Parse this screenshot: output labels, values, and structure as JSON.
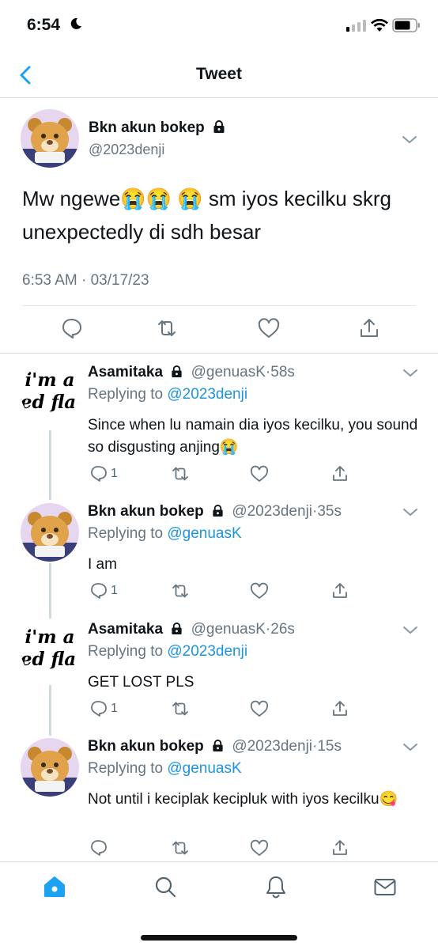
{
  "status": {
    "time": "6:54"
  },
  "nav": {
    "title": "Tweet"
  },
  "main_tweet": {
    "name": "Bkn akun bokep",
    "handle": "@2023denji",
    "text": "Mw ngewe😭😭 😭 sm iyos kecilku skrg unexpectedly di sdh besar",
    "timestamp": "6:53 AM · 03/17/23"
  },
  "replies": [
    {
      "name": "Asamitaka",
      "handle": "@genuasK",
      "time": "58s",
      "replying_label": "Replying to",
      "replying_to": "@2023denji",
      "text": "Since when lu namain dia iyos kecilku, you sound so disgusting anjing😭",
      "reply_count": "1",
      "avatar": "red-flag"
    },
    {
      "name": "Bkn akun bokep",
      "handle": "@2023denji",
      "time": "35s",
      "replying_label": "Replying to",
      "replying_to": "@genuasK",
      "text": "I am",
      "reply_count": "1",
      "avatar": "bear"
    },
    {
      "name": "Asamitaka",
      "handle": "@genuasK",
      "time": "26s",
      "replying_label": "Replying to",
      "replying_to": "@2023denji",
      "text": "GET LOST PLS",
      "reply_count": "1",
      "avatar": "red-flag"
    },
    {
      "name": "Bkn akun bokep",
      "handle": "@2023denji",
      "time": "15s",
      "replying_label": "Replying to",
      "replying_to": "@genuasK",
      "text": "Not until i keciplak kecipluk with iyos kecilku😋",
      "reply_count": "",
      "avatar": "bear"
    }
  ],
  "redflag_avatar_text": {
    "line1": "i'm a",
    "line2": "red flag"
  },
  "tabs": [
    "home-icon",
    "search-icon",
    "notifications-icon",
    "messages-icon"
  ],
  "colors": {
    "accent": "#1da1f2",
    "secondary_text": "#66757f",
    "link": "#1b95e0"
  }
}
